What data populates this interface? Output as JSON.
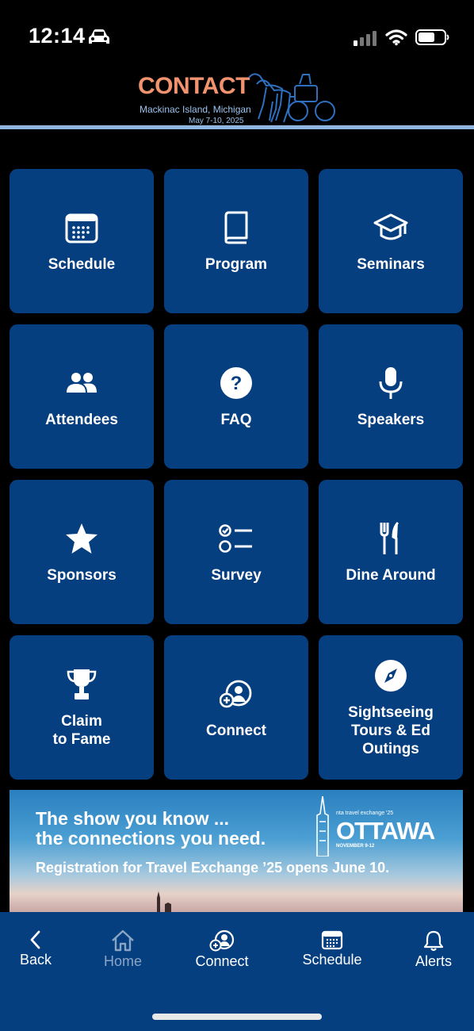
{
  "status_bar": {
    "time": "12:14"
  },
  "header": {
    "logo_title": "CONTACT",
    "logo_subtitle": "Mackinac Island, Michigan",
    "logo_dates": "May 7-10, 2025"
  },
  "tiles": [
    {
      "label": "Schedule",
      "icon": "calendar-icon"
    },
    {
      "label": "Program",
      "icon": "book-icon"
    },
    {
      "label": "Seminars",
      "icon": "graduation-cap-icon"
    },
    {
      "label": "Attendees",
      "icon": "users-icon"
    },
    {
      "label": "FAQ",
      "icon": "question-circle-icon"
    },
    {
      "label": "Speakers",
      "icon": "microphone-icon"
    },
    {
      "label": "Sponsors",
      "icon": "star-icon"
    },
    {
      "label": "Survey",
      "icon": "checklist-icon"
    },
    {
      "label": "Dine Around",
      "icon": "fork-knife-icon"
    },
    {
      "label": "Claim\nto Fame",
      "icon": "trophy-icon"
    },
    {
      "label": "Connect",
      "icon": "connect-user-icon"
    },
    {
      "label": "Sightseeing\nTours & Ed\nOutings",
      "icon": "compass-icon"
    }
  ],
  "banner": {
    "line1": "The show you know ...",
    "line2": "the connections you need.",
    "registration": "Registration for Travel Exchange ’25 opens June 10.",
    "brand_small": "nta travel exchange '25",
    "city": "OTTAWA",
    "dates": "NOVEMBER 9-12"
  },
  "bottom_nav": {
    "back": "Back",
    "home": "Home",
    "connect": "Connect",
    "schedule": "Schedule",
    "alerts": "Alerts"
  }
}
